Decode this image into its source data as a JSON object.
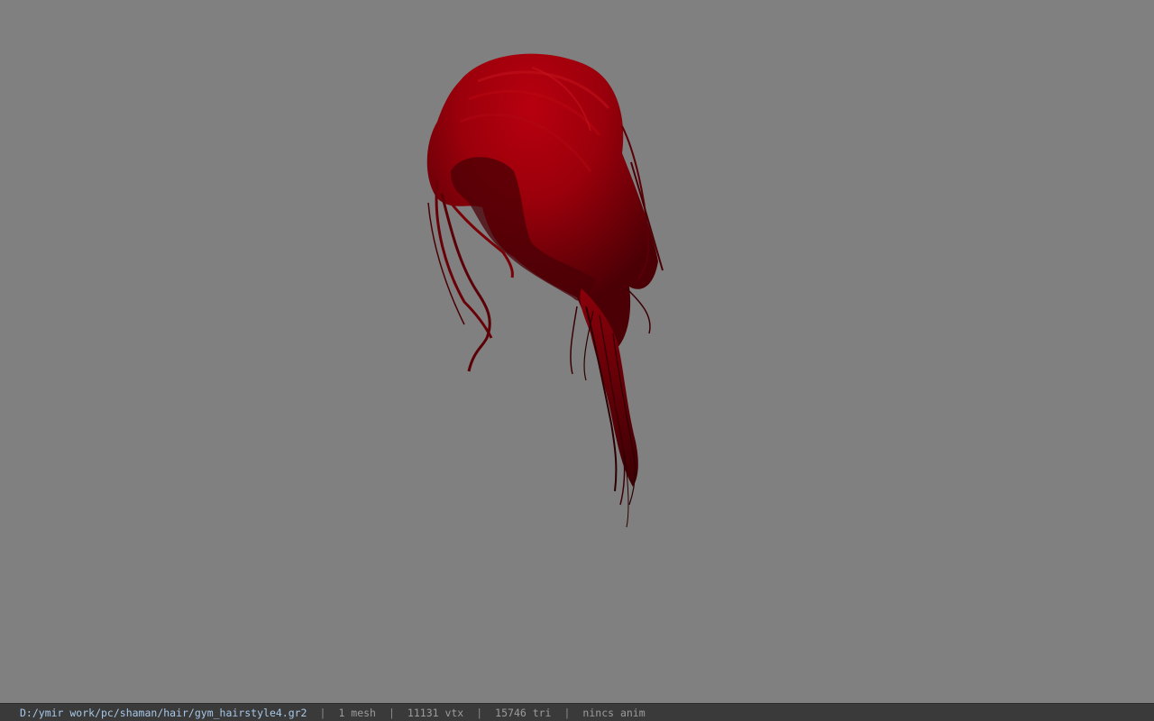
{
  "viewport": {
    "background_color": "#808080",
    "model": {
      "name": "hair-model",
      "color": "#a3000c",
      "shadow_color": "#3f0004"
    }
  },
  "status_bar": {
    "file_path": "D:/ymir work/pc/shaman/hair/gym_hairstyle4.gr2",
    "mesh_count": "1 mesh",
    "vertex_count": "11131 vtx",
    "triangle_count": "15746 tri",
    "anim": "nincs anim",
    "separator": "|"
  }
}
